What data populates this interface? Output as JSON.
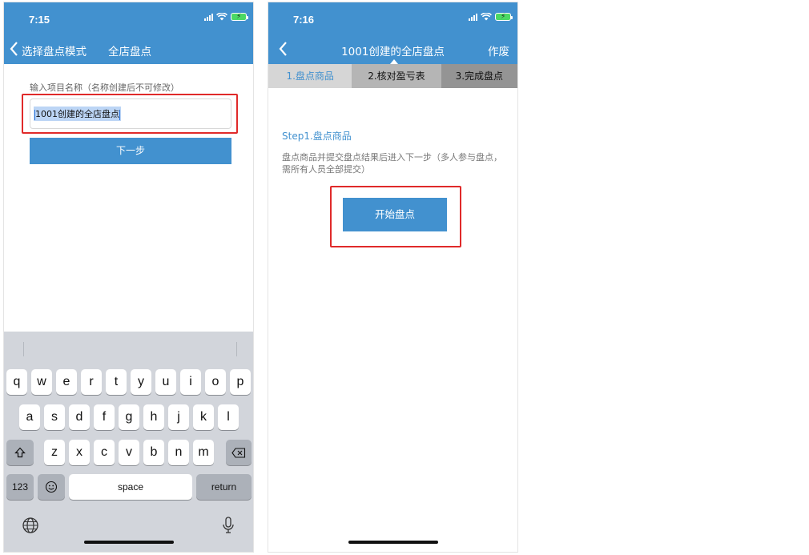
{
  "screen1": {
    "status_time": "7:15",
    "nav": {
      "back_label": "选择盘点模式",
      "title": "全店盘点"
    },
    "form": {
      "label": "输入项目名称（名称创建后不可修改）",
      "input_value": "1001创建的全店盘点",
      "next_button": "下一步"
    },
    "keyboard": {
      "row1": [
        "q",
        "w",
        "e",
        "r",
        "t",
        "y",
        "u",
        "i",
        "o",
        "p"
      ],
      "row2": [
        "a",
        "s",
        "d",
        "f",
        "g",
        "h",
        "j",
        "k",
        "l"
      ],
      "row3": [
        "z",
        "x",
        "c",
        "v",
        "b",
        "n",
        "m"
      ],
      "numbers_key": "123",
      "space_key": "space",
      "return_key": "return"
    }
  },
  "screen2": {
    "status_time": "7:16",
    "nav": {
      "title": "1001创建的全店盘点",
      "right_action": "作废"
    },
    "tabs": [
      "1.盘点商品",
      "2.核对盈亏表",
      "3.完成盘点"
    ],
    "step_title": "Step1.盘点商品",
    "step_description": "盘点商品并提交盘点结果后进入下一步（多人参与盘点，需所有人员全部提交）",
    "start_button": "开始盘点"
  },
  "colors": {
    "brand_blue": "#4291cf",
    "highlight_red": "#e02a2a"
  }
}
